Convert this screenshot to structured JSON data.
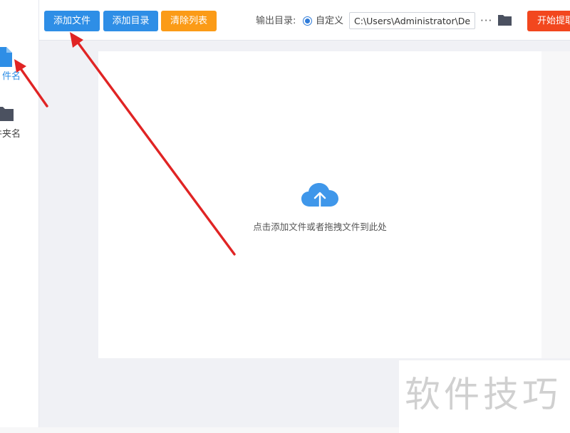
{
  "sidebar": {
    "items": [
      {
        "label": "件名",
        "icon": "file-icon",
        "active": true
      },
      {
        "label": "件夹名",
        "icon": "folder-icon",
        "active": false
      }
    ]
  },
  "toolbar": {
    "add_file": "添加文件",
    "add_dir": "添加目录",
    "clear_list": "清除列表",
    "output_label": "输出目录:",
    "custom_label": "自定义",
    "output_path": "C:\\Users\\Administrator\\Desktop",
    "more_label": "···",
    "start_label": "开始提取"
  },
  "main": {
    "hint": "点击添加文件或者拖拽文件到此处"
  },
  "watermark": {
    "text": "软件技巧"
  },
  "colors": {
    "accent": "#2e8ee6",
    "orange": "#fb9b17",
    "red": "#f2471e",
    "arrow": "#e02424",
    "cloud": "#3f97ea"
  }
}
